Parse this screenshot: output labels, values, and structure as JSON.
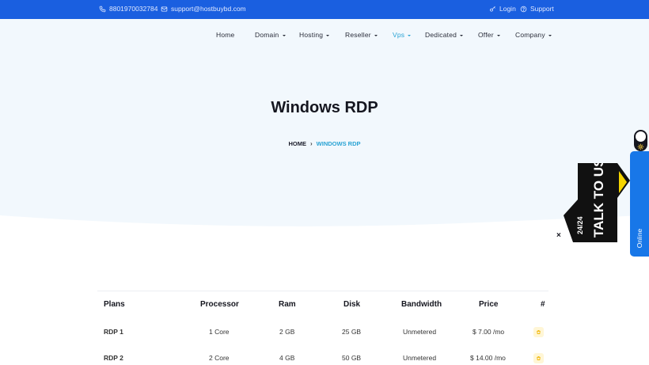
{
  "topbar": {
    "phone": "8801970032784",
    "email": "support@hostbuybd.com",
    "login": "Login",
    "support": "Support"
  },
  "nav": {
    "home": "Home",
    "domain": "Domain",
    "hosting": "Hosting",
    "reseller": "Reseller",
    "vps": "Vps",
    "dedicated": "Dedicated",
    "offer": "Offer",
    "company": "Company"
  },
  "hero": {
    "title": "Windows RDP",
    "breadcrumb_home": "HOME",
    "breadcrumb_current": "WINDOWS RDP"
  },
  "table": {
    "headers": [
      "Plans",
      "Processor",
      "Ram",
      "Disk",
      "Bandwidth",
      "Price",
      "#"
    ],
    "rows": [
      [
        "RDP 1",
        "1 Core",
        "2 GB",
        "25 GB",
        "Unmetered",
        "$ 7.00 /mo"
      ],
      [
        "RDP 2",
        "2 Core",
        "4 GB",
        "50 GB",
        "Unmetered",
        "$ 14.00 /mo"
      ]
    ]
  },
  "widgets": {
    "online_label": "Online",
    "talk_line1": "TALK TO US",
    "talk_line2": "24/24",
    "close": "×"
  },
  "colors": {
    "topbar": "#1a5fe0",
    "accent": "#2aa3d4",
    "chat_tab": "#1877e8",
    "cart_bg": "#fff6d6",
    "cart_icon": "#f0b400"
  }
}
